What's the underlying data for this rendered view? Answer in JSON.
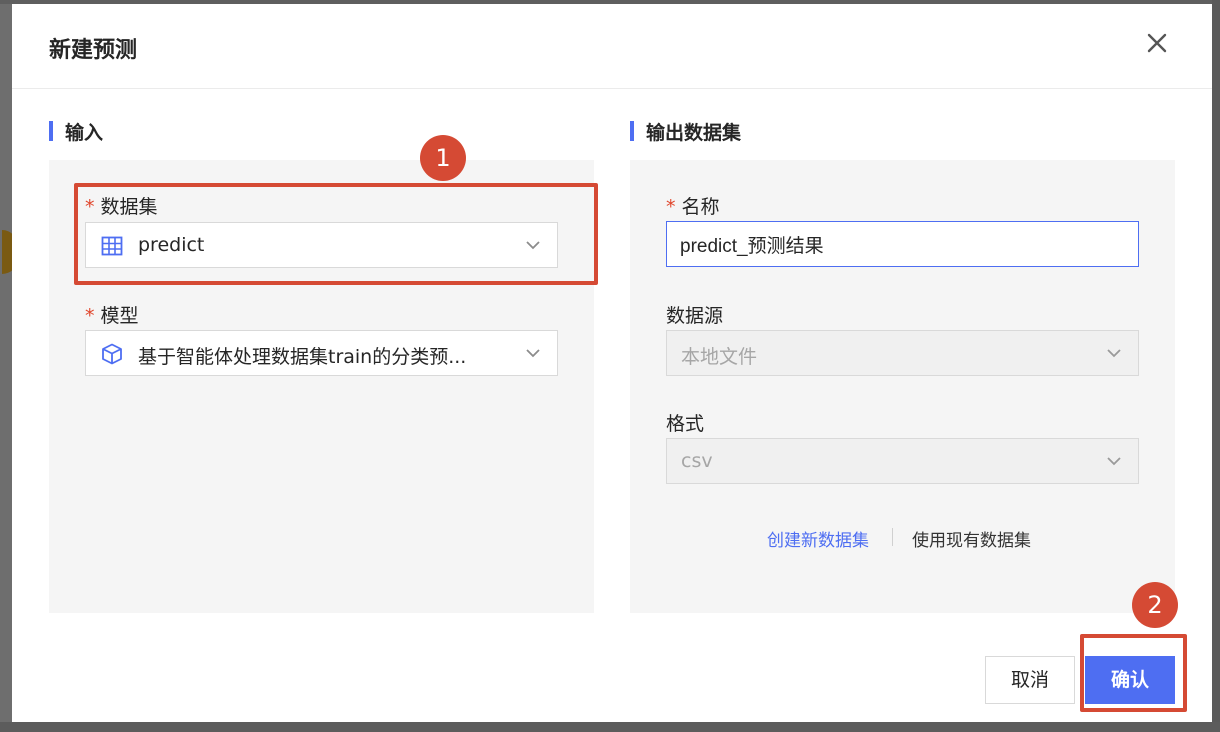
{
  "dialog": {
    "title": "新建预测",
    "close_icon": "close-icon"
  },
  "input_section": {
    "title": "输入",
    "dataset": {
      "required_mark": "*",
      "label": "数据集",
      "value": "predict",
      "icon": "table-icon"
    },
    "model": {
      "required_mark": "*",
      "label": "模型",
      "value": "基于智能体处理数据集train的分类预...",
      "icon": "cube-icon"
    }
  },
  "output_section": {
    "title": "输出数据集",
    "name": {
      "required_mark": "*",
      "label": "名称",
      "value": "predict_预测结果"
    },
    "datasource": {
      "label": "数据源",
      "value": "本地文件"
    },
    "format": {
      "label": "格式",
      "value": "csv"
    },
    "links": {
      "create_new": "创建新数据集",
      "use_existing": "使用现有数据集"
    }
  },
  "footer": {
    "cancel_label": "取消",
    "ok_label": "确认"
  },
  "annotations": {
    "badge_1": "1",
    "badge_2": "2"
  },
  "colors": {
    "accent": "#4e6ef2",
    "annotation": "#d54a34",
    "required": "#e0452b"
  }
}
